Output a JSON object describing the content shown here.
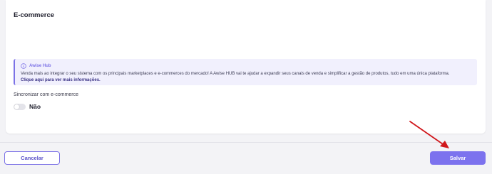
{
  "card": {
    "title": "E-commerce"
  },
  "info": {
    "title": "Awise Hub",
    "text": "Venda mais ao integrar o seu sistema com os principais marketplaces e e-commerces do mercado! A Awise HUB vai te ajudar a expandir seus canais de venda e simplificar a gestão de produtos, tudo em uma única plataforma.",
    "link": "Clique aqui para ver mais informações."
  },
  "sync": {
    "label": "Sincronizar com e-commerce",
    "toggle_value": "Não",
    "enabled": false
  },
  "footer": {
    "cancel_label": "Cancelar",
    "save_label": "Salvar"
  },
  "colors": {
    "accent": "#7c72ee",
    "annotation_arrow": "#d0161b"
  }
}
